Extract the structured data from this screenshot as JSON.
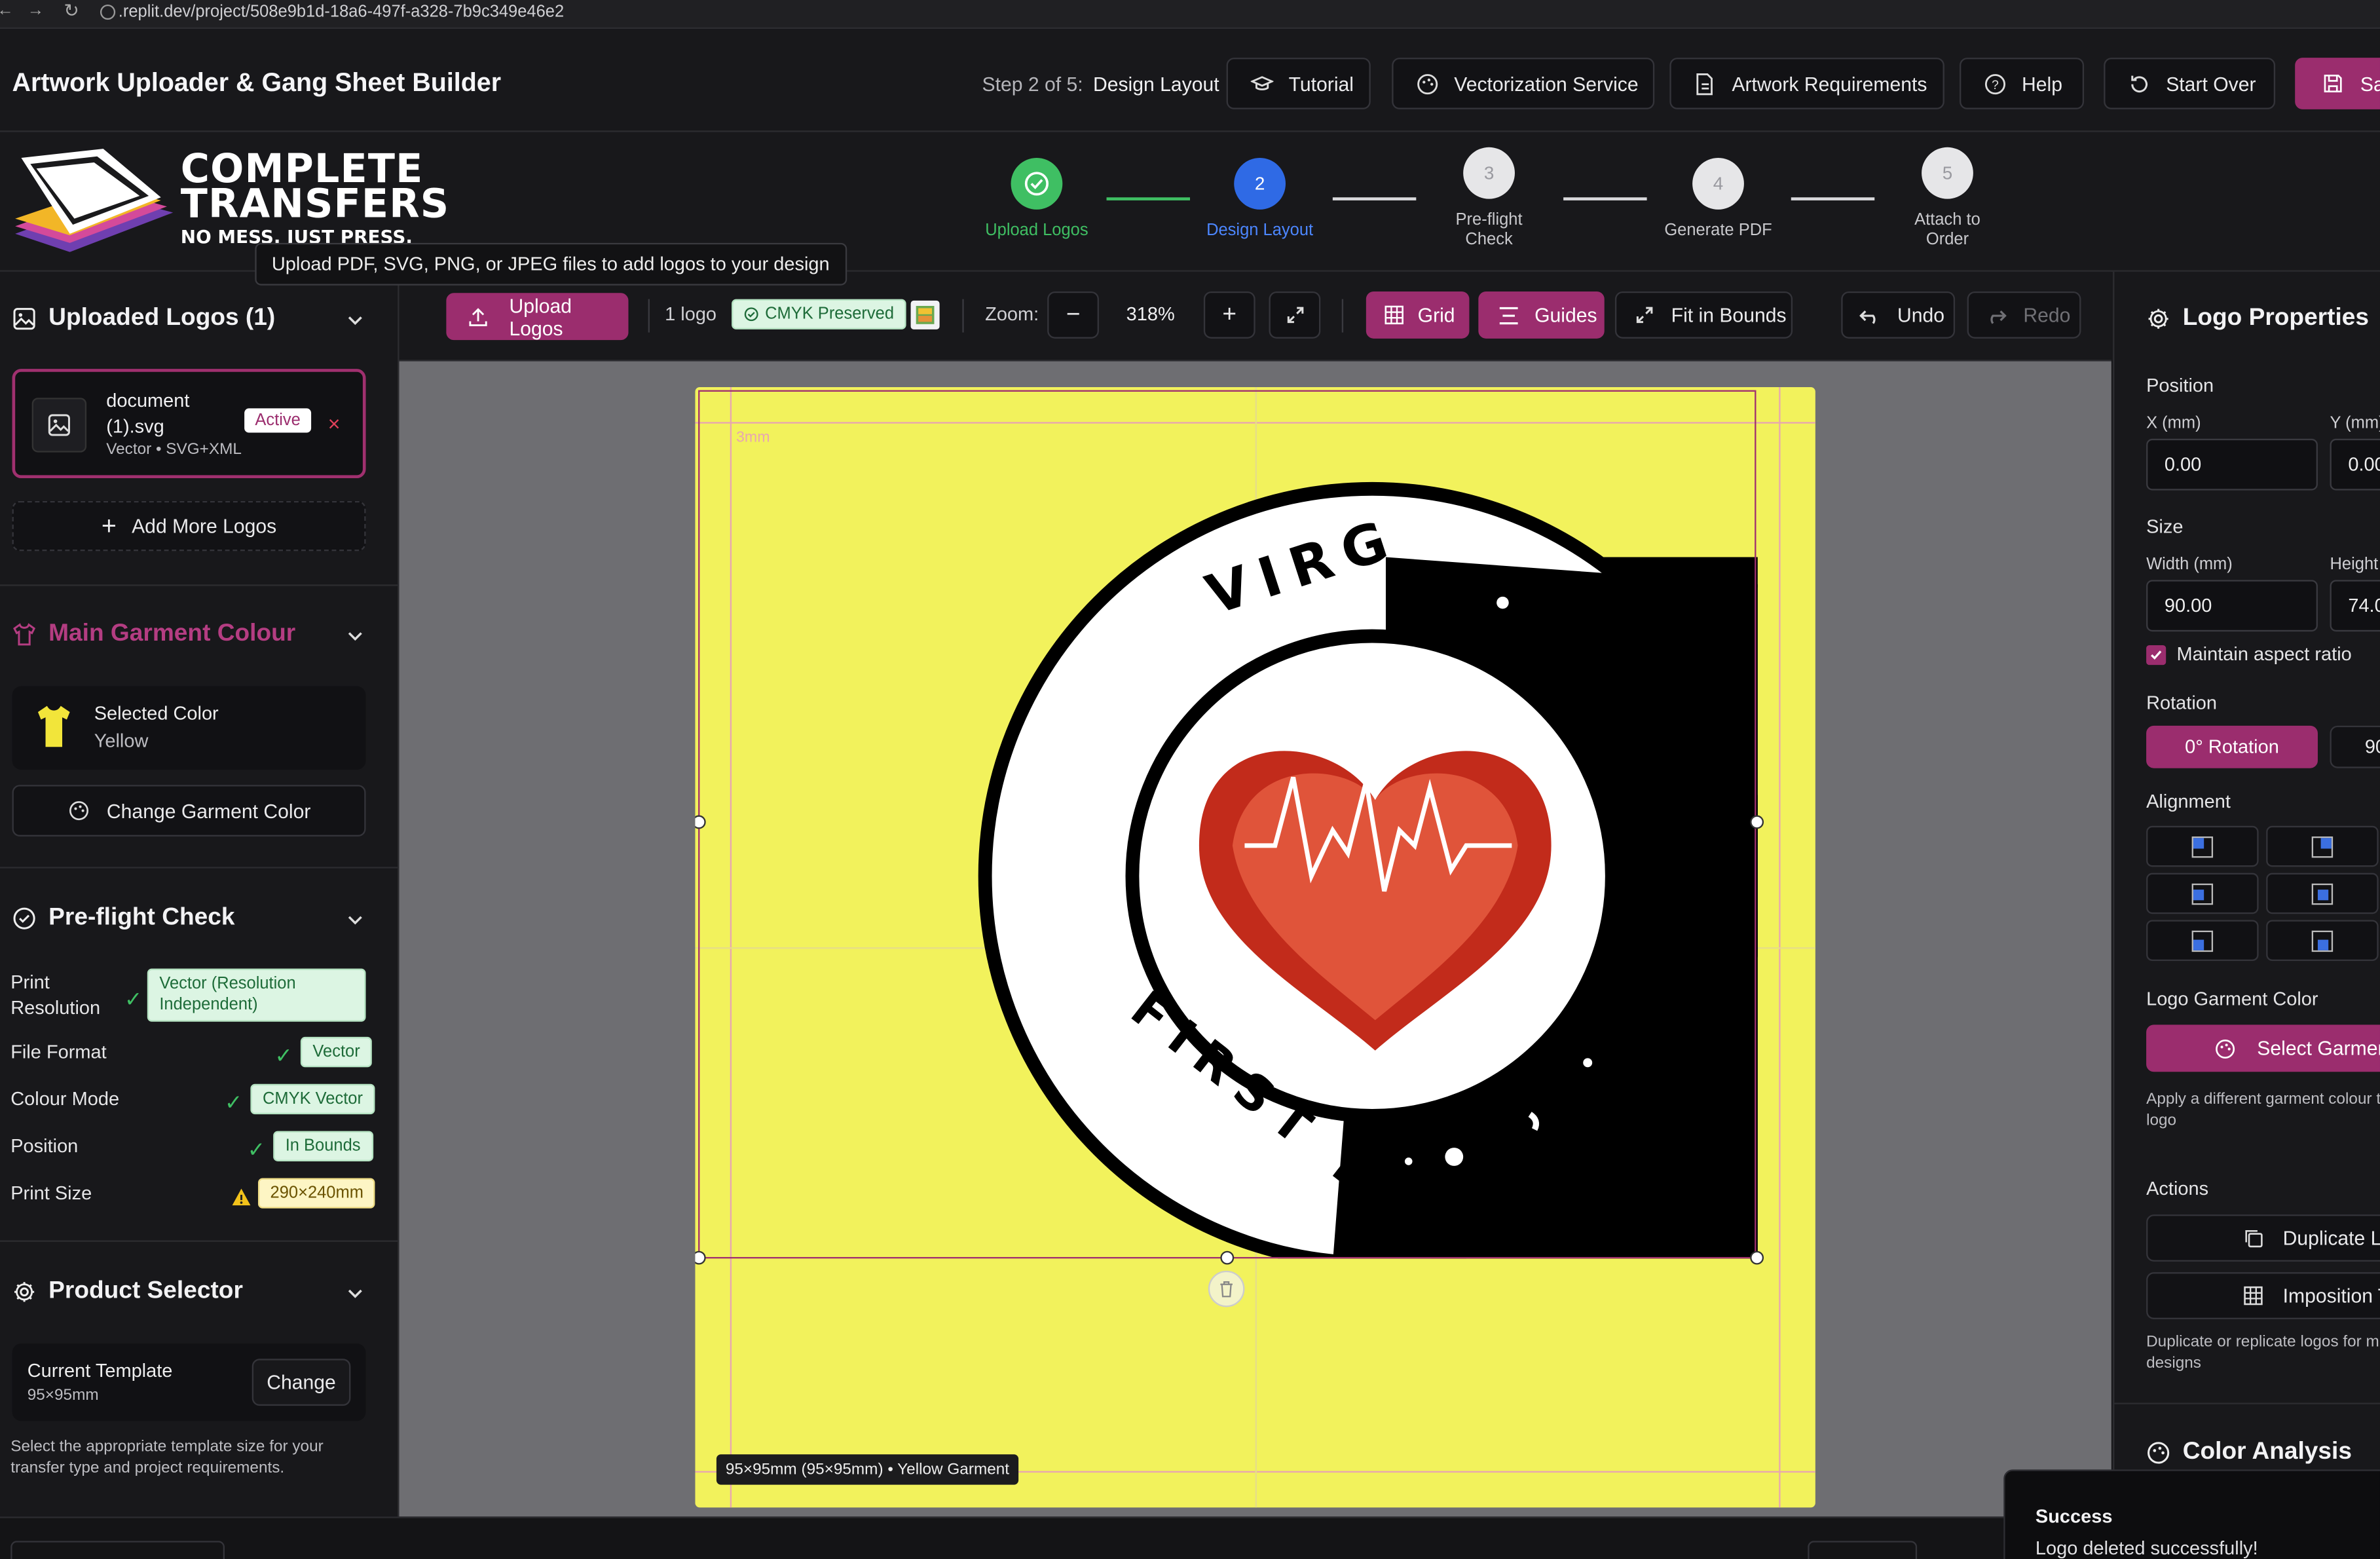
{
  "browser": {
    "url": ".replit.dev/project/508e9b1d-18a6-497f-a328-7b9c349e46e2"
  },
  "header": {
    "title": "Artwork Uploader & Gang Sheet Builder",
    "step_prefix": "Step 2 of 5:",
    "step_name": "Design Layout",
    "buttons": {
      "tutorial": "Tutorial",
      "vectorization": "Vectorization Service",
      "requirements": "Artwork Requirements",
      "help": "Help",
      "start_over": "Start Over",
      "save": "Sa"
    }
  },
  "brand": {
    "line1": "COMPLETE",
    "line2": "TRANSFERS",
    "tagline": "NO MESS. JUST PRESS."
  },
  "tooltip": "Upload PDF, SVG, PNG, or JPEG files to add logos to your design",
  "stepper": [
    {
      "label": "Upload Logos",
      "num": "",
      "state": "done"
    },
    {
      "label": "Design Layout",
      "num": "2",
      "state": "active"
    },
    {
      "label": "Pre-flight Check",
      "num": "3",
      "state": "pending"
    },
    {
      "label": "Generate PDF",
      "num": "4",
      "state": "pending"
    },
    {
      "label": "Attach to Order",
      "num": "5",
      "state": "pending"
    }
  ],
  "sidebar": {
    "uploaded": {
      "title": "Uploaded Logos (1)",
      "file_name_1": "document",
      "file_name_2": "(1).svg",
      "file_meta": "Vector • SVG+XML",
      "active_badge": "Active",
      "remove": "×",
      "add_more": "Add More Logos"
    },
    "garment": {
      "title": "Main Garment Colour",
      "selected_label": "Selected Color",
      "selected_value": "Yellow",
      "change_button": "Change Garment Color",
      "swatch_color": "#f2e53a"
    },
    "preflight": {
      "title": "Pre-flight Check",
      "items": [
        {
          "label": "Print Resolution",
          "value": "Vector (Resolution Independent)",
          "status": "ok"
        },
        {
          "label": "File Format",
          "value": "Vector",
          "status": "ok"
        },
        {
          "label": "Colour Mode",
          "value": "CMYK Vector",
          "status": "ok"
        },
        {
          "label": "Position",
          "value": "In Bounds",
          "status": "ok"
        },
        {
          "label": "Print Size",
          "value": "290×240mm",
          "status": "warn"
        }
      ]
    },
    "product": {
      "title": "Product Selector",
      "template_label": "Current Template",
      "template_value": "95×95mm",
      "change_button": "Change",
      "help_text": "Select the appropriate template size for your transfer type and project requirements."
    }
  },
  "toolbar": {
    "upload": "Upload Logos",
    "logo_count": "1 logo",
    "cmyk": "CMYK Preserved",
    "zoom_label": "Zoom:",
    "zoom_minus": "−",
    "zoom_value": "318%",
    "zoom_plus": "+",
    "grid": "Grid",
    "guides": "Guides",
    "fit": "Fit in Bounds",
    "undo": "Undo",
    "redo": "Redo"
  },
  "canvas": {
    "bleed_label": "3mm",
    "garment_color": "#f2f25c",
    "logo_text_top": "VIRG",
    "logo_text_bottom": "FIRST RE",
    "info": "95×95mm (95×95mm) • Yellow Garment"
  },
  "properties": {
    "title": "Logo Properties",
    "position_label": "Position",
    "x_label": "X (mm)",
    "x_value": "0.00",
    "y_label": "Y (mm)",
    "y_value": "0.00",
    "size_label": "Size",
    "width_label": "Width (mm)",
    "width_value": "90.00",
    "height_label": "Height (",
    "height_value": "74.0",
    "aspect": "Maintain aspect ratio",
    "rotation_label": "Rotation",
    "rot0": "0° Rotation",
    "rot90": "90",
    "alignment_label": "Alignment",
    "garment_color_label": "Logo Garment Color",
    "select_garment": "Select Garment",
    "apply_text": "Apply a different garment colour to logo",
    "actions_label": "Actions",
    "duplicate": "Duplicate Lo",
    "imposition": "Imposition T",
    "dup_help": "Duplicate or replicate logos for mu designs",
    "color_analysis": "Color Analysis"
  },
  "toast": {
    "title": "Success",
    "message": "Logo deleted successfully!"
  }
}
